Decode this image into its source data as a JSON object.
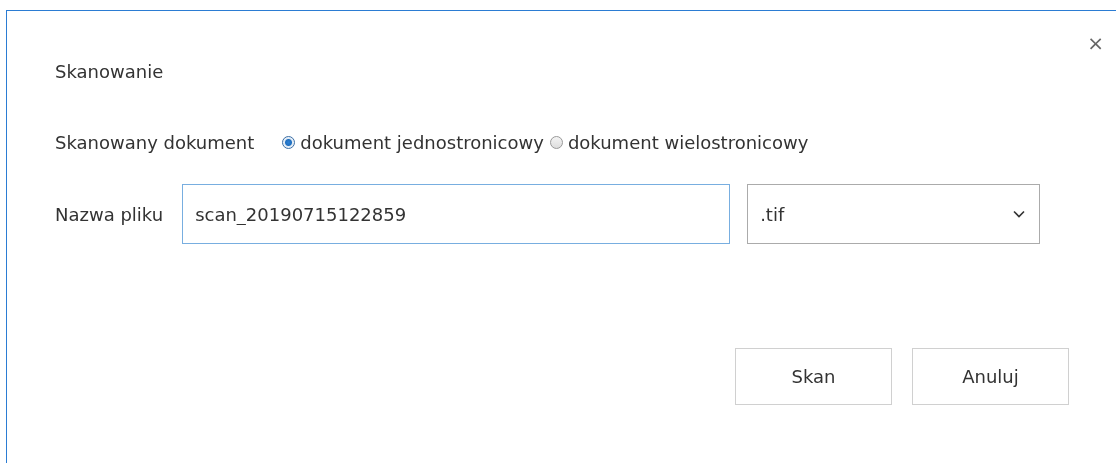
{
  "dialog": {
    "title": "Skanowanie",
    "close": "×"
  },
  "document_type": {
    "label": "Skanowany dokument",
    "options": [
      {
        "label": "dokument jednostronicowy",
        "selected": true
      },
      {
        "label": "dokument wielostronicowy",
        "selected": false
      }
    ]
  },
  "file_name": {
    "label": "Nazwa pliku",
    "value": "scan_20190715122859",
    "extension": ".tif"
  },
  "buttons": [
    {
      "label": "Skan"
    },
    {
      "label": "Anuluj"
    }
  ]
}
